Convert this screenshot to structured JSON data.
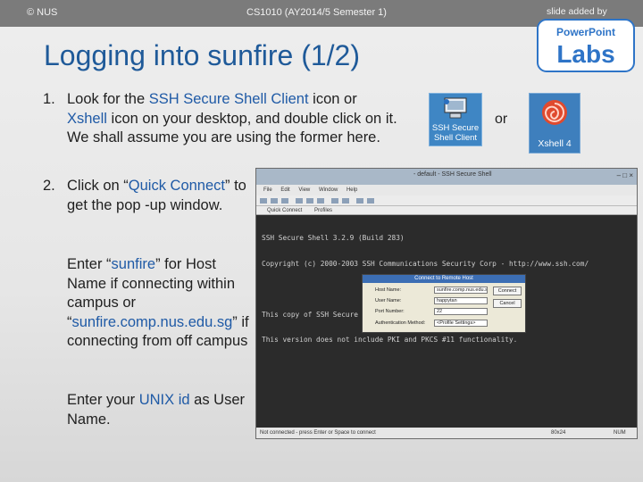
{
  "header": {
    "copyright": "© NUS",
    "course": "CS1010 (AY2014/5 Semester 1)",
    "slide_added_by": "slide added by",
    "logo_text": "PowerPoint Labs"
  },
  "title": "Logging into sunfire (1/2)",
  "items": [
    {
      "number": "1.",
      "segments": [
        {
          "text": "Look for the ",
          "style": "normal"
        },
        {
          "text": "SSH Secure Shell Client",
          "style": "blue"
        },
        {
          "text": " icon or ",
          "style": "normal"
        },
        {
          "text": "Xshell",
          "style": "blue"
        },
        {
          "text": " icon on your desktop, and double click on it. We shall assume you are using the former here.",
          "style": "normal"
        }
      ]
    },
    {
      "number": "2.",
      "segments": [
        {
          "text": "Click on “",
          "style": "normal"
        },
        {
          "text": "Quick Connect",
          "style": "blue"
        },
        {
          "text": "” to get the pop -up window.",
          "style": "normal"
        }
      ]
    }
  ],
  "para_host": {
    "segments": [
      {
        "text": "Enter “",
        "style": "normal"
      },
      {
        "text": "sunfire",
        "style": "blue"
      },
      {
        "text": "” for Host Name if connecting within campus or “",
        "style": "normal"
      },
      {
        "text": "sunfire.comp.nus.edu.sg",
        "style": "blue"
      },
      {
        "text": "” if connecting from off campus",
        "style": "normal"
      }
    ]
  },
  "para_user": {
    "segments": [
      {
        "text": "Enter your ",
        "style": "normal"
      },
      {
        "text": "UNIX id",
        "style": "blue"
      },
      {
        "text": " as User Name.",
        "style": "normal"
      }
    ]
  },
  "icons": {
    "ssh_label_line1": "SSH Secure",
    "ssh_label_line2": "Shell Client",
    "or_text": "or",
    "xshell_label": "Xshell 4"
  },
  "ssh_window": {
    "title": "- default - SSH Secure Shell",
    "controls": "–  □  ×",
    "menu": [
      "File",
      "Edit",
      "View",
      "Window",
      "Help"
    ],
    "links": [
      "Quick Connect",
      "Profiles"
    ],
    "terminal": [
      "SSH Secure Shell 3.2.9 (Build 283)",
      "Copyright (c) 2000-2003 SSH Communications Security Corp - http://www.ssh.com/",
      "",
      "This copy of SSH Secure Shell is a non-commercial version.",
      "This version does not include PKI and PKCS #11 functionality."
    ],
    "status_left": "Not connected - press Enter or Space to connect",
    "status_size": "80x24",
    "status_num": "NUM",
    "dialog": {
      "title": "Connect to Remote Host",
      "host_label": "Host Name:",
      "host_value": "sunfire.comp.nus.edu.sg",
      "user_label": "User Name:",
      "user_value": "happytan",
      "port_label": "Port Number:",
      "port_value": "22",
      "auth_label": "Authentication Method:",
      "auth_value": "<Profile Settings>",
      "connect_label": "Connect",
      "cancel_label": "Cancel"
    }
  },
  "colors": {
    "title": "#1f5a99",
    "highlight": "#1f5aa6",
    "topbar": "#7b7b7b",
    "logo_blue": "#2e74c7"
  }
}
